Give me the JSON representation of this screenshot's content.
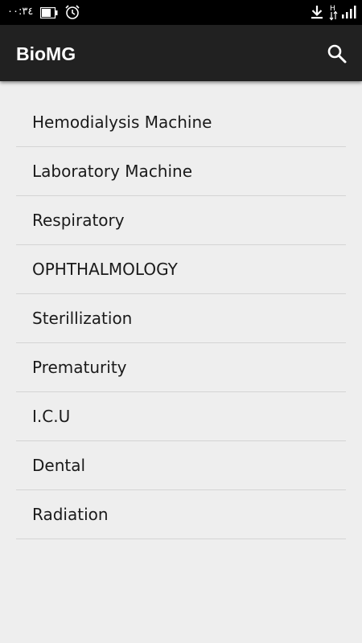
{
  "status_bar": {
    "time": "٠٠:٣٤",
    "network_type": "H",
    "icons": [
      "battery-icon",
      "alarm-icon",
      "download-icon",
      "network-type-icon",
      "signal-icon"
    ]
  },
  "app_bar": {
    "title": "BioMG",
    "search_icon": "search-icon"
  },
  "categories": [
    "Hemodialysis Machine",
    "Laboratory Machine",
    "Respiratory",
    "OPHTHALMOLOGY",
    "Sterillization",
    "Prematurity",
    "I.C.U",
    "Dental",
    "Radiation"
  ],
  "colors": {
    "app_bar": "#212121",
    "status_bar": "#000000",
    "background": "#eeeeee",
    "divider": "#d4d4d4",
    "text": "#1a1a1a"
  }
}
